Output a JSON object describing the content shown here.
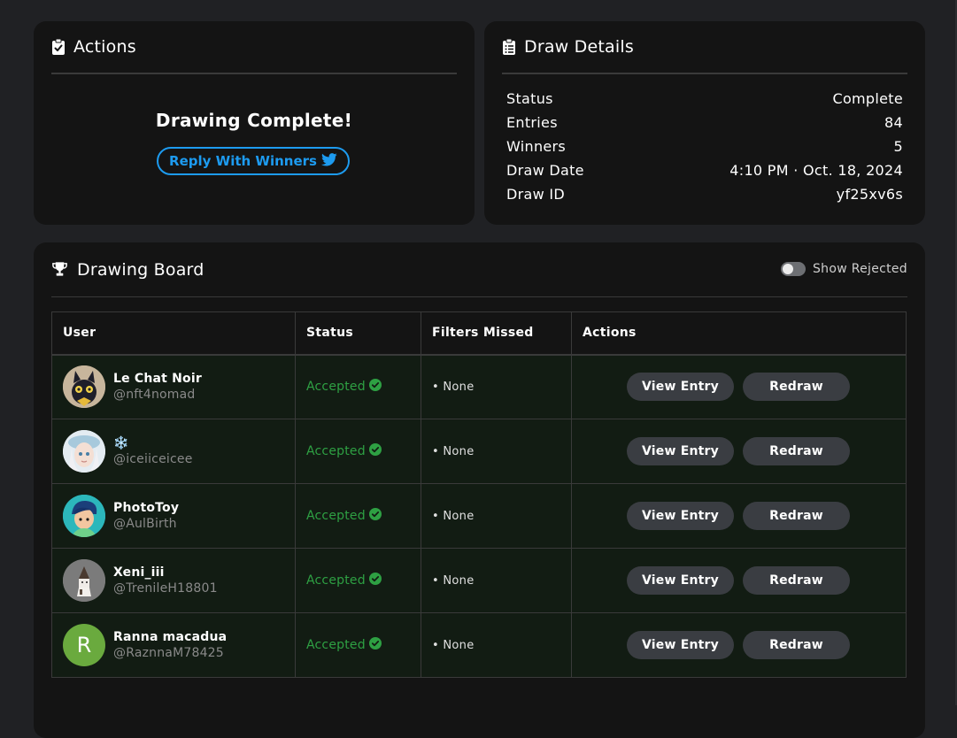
{
  "actions_card": {
    "title": "Actions",
    "complete_text": "Drawing Complete!",
    "reply_button": "Reply With Winners"
  },
  "details_card": {
    "title": "Draw Details",
    "rows": [
      {
        "label": "Status",
        "value": "Complete"
      },
      {
        "label": "Entries",
        "value": "84"
      },
      {
        "label": "Winners",
        "value": "5"
      },
      {
        "label": "Draw Date",
        "value": "4:10 PM · Oct. 18, 2024"
      },
      {
        "label": "Draw ID",
        "value": "yf25xv6s"
      }
    ]
  },
  "board": {
    "title": "Drawing Board",
    "toggle_label": "Show Rejected",
    "toggle_on": false,
    "columns": [
      "User",
      "Status",
      "Filters Missed",
      "Actions"
    ],
    "view_label": "View Entry",
    "redraw_label": "Redraw",
    "rows": [
      {
        "name": "Le Chat Noir",
        "handle": "@nft4nomad",
        "status": "Accepted",
        "filters": "• None"
      },
      {
        "name": "❄️",
        "handle": "@iceiiceicee",
        "status": "Accepted",
        "filters": "• None"
      },
      {
        "name": "PhotoToy",
        "handle": "@AulBirth",
        "status": "Accepted",
        "filters": "• None"
      },
      {
        "name": "Xeni_iii",
        "handle": "@TrenileH18801",
        "status": "Accepted",
        "filters": "• None"
      },
      {
        "name": "Ranna macadua",
        "handle": "@RaznnaM78425",
        "status": "Accepted",
        "filters": "• None",
        "avatar_letter": "R"
      }
    ]
  },
  "colors": {
    "accent_blue": "#1d9bf0",
    "accepted_green": "#2ea043",
    "card_bg": "#141414",
    "page_bg": "#202124",
    "row_bg": "#121c13"
  }
}
